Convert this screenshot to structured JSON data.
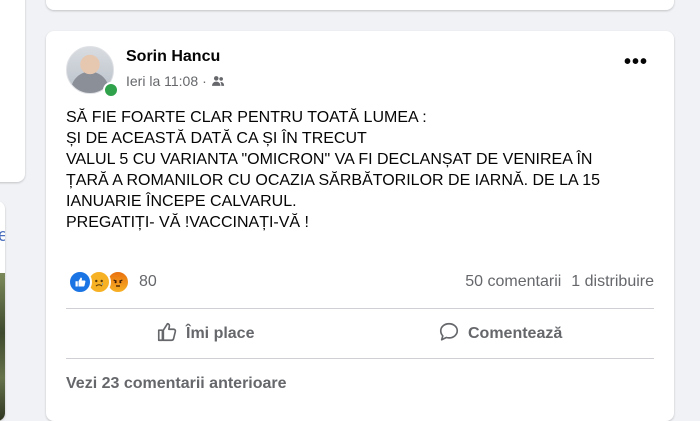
{
  "post": {
    "author": "Sorin Hancu",
    "timestamp": "Ieri la 11:08",
    "privacy_icon": "friends-icon",
    "more_label": "•••",
    "text_lines": [
      "SĂ FIE FOARTE CLAR PENTRU TOATĂ LUMEA  :",
      "ȘI DE ACEASTĂ DATĂ CA ȘI ÎN TRECUT",
      "VALUL 5 CU VARIANTA \"OMICRON\" VA FI DECLANȘAT DE VENIREA ÎN",
      "ȚARĂ A ROMANILOR CU OCAZIA SĂRBĂTORILOR DE IARNĂ. DE LA 15",
      "IANUARIE ÎNCEPE CALVARUL.",
      "PREGATIȚI- VĂ !VACCINAȚI-VĂ !"
    ],
    "reactions": {
      "icons": [
        "like-icon",
        "sad-icon",
        "angry-icon"
      ],
      "count": "80"
    },
    "comments_count": "50 comentarii",
    "shares_count": "1 distribuire",
    "actions": {
      "like_label": "Îmi place",
      "comment_label": "Comentează"
    },
    "previous_comments": "Vezi 23 comentarii anterioare"
  },
  "side": {
    "fragment_text": "e"
  },
  "colors": {
    "accent": "#1b74e4",
    "online": "#31a24c",
    "secondary_text": "#65676b"
  }
}
